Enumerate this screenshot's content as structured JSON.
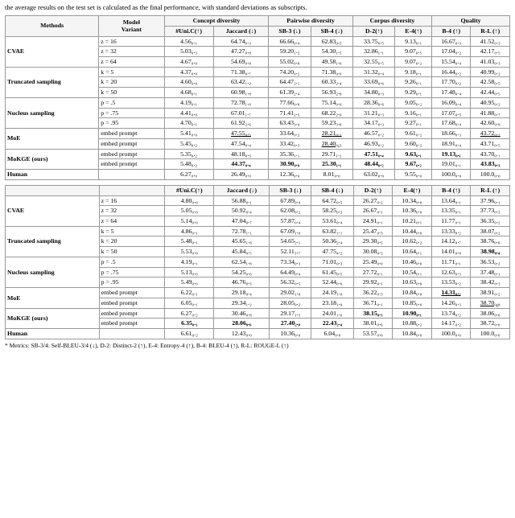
{
  "intro": "the average results on the test set is calculated as the final performance, with standard deviations as subscripts.",
  "table1": {
    "col_groups": [
      {
        "label": "Methods",
        "cols": [
          "Model Variant"
        ]
      },
      {
        "label": "Concept diversity",
        "cols": [
          "#Uni.C(↑)",
          "Jaccard (↓)"
        ]
      },
      {
        "label": "Pairwise diversity",
        "cols": [
          "SB-3 (↓)",
          "SB-4 (↓)"
        ]
      },
      {
        "label": "Corpus diversity",
        "cols": [
          "D-2(↑)",
          "E-4(↑)"
        ]
      },
      {
        "label": "Quality",
        "cols": [
          "B-4 (↑)",
          "R-L (↑)"
        ]
      }
    ],
    "rows": [
      {
        "method": "CVAE",
        "variants": [
          {
            "var": "z = 16",
            "vals": [
              "4.56₀.₁",
              "64.74₀.₃",
              "66.66₀.₄",
              "62.83₀.₅",
              "33.75₀.₅",
              "9.13₀.₁",
              "16.67₀.₃",
              "41.52₀.₃"
            ]
          },
          {
            "var": "z = 32",
            "vals": [
              "5.03₀.₃",
              "47.27₀.₈",
              "59.20₁.₃",
              "54.30₁.₅",
              "32.86₁.₁",
              "9.07₀.₅",
              "17.04₀.₂",
              "42.17₀.₅"
            ]
          },
          {
            "var": "z = 64",
            "vals": [
              "4.67₀.₀",
              "54.69₀.₈",
              "55.02₀.₈",
              "49.58₁.₀",
              "32.55₀.₅",
              "9.07₀.₂",
              "15.54₀.₄",
              "41.03₀.₃"
            ]
          }
        ]
      },
      {
        "method": "Truncated sampling",
        "variants": [
          {
            "var": "k = 5",
            "vals": [
              "4.37₀.₀",
              "71.38₀.₇",
              "74.20₀.₂",
              "71.38₀.₀",
              "31.32₀.₄",
              "9.18₀.₁",
              "16.44₀.₂",
              "40.99₀.₂"
            ]
          },
          {
            "var": "k = 20",
            "vals": [
              "4.60₀.₀",
              "63.42₁.₂",
              "64.47₂.₁",
              "60.33₂.₄",
              "33.69₀.₆",
              "9.26₀.₁",
              "17.70₀.₂",
              "42.58₀.₅"
            ]
          },
          {
            "var": "k = 50",
            "vals": [
              "4.68₀.₁",
              "60.98₁.₈",
              "61.39₂.₄",
              "56.93₂.₈",
              "34.80₀.₃",
              "9.29₀.₁",
              "17.48₀.₄",
              "42.44₀.₅"
            ]
          }
        ]
      },
      {
        "method": "Nucleus sampling",
        "variants": [
          {
            "var": "p = .5",
            "vals": [
              "4.19₀.₁",
              "72.78₁.₀",
              "77.66₀.₈",
              "75.14₀.₉",
              "28.36₀.₆",
              "9.05₀.₂",
              "16.09₀.₄",
              "40.95₀.₂"
            ]
          },
          {
            "var": "p = .75",
            "vals": [
              "4.41₀.₀",
              "67.01₁.₇",
              "71.41₂.₅",
              "68.22₂.₉",
              "31.21₀.₃",
              "9.16₀.₁",
              "17.07₀.₅",
              "41.88₀.₇"
            ]
          },
          {
            "var": "p = .95",
            "vals": [
              "4.70₀.₁",
              "61.92₂.₆",
              "63.43₃.₄",
              "59.23₃.₈",
              "34.17₀.₃",
              "9.27₀.₁",
              "17.68₀.₄",
              "42.60₀.₈"
            ]
          }
        ]
      },
      {
        "method": "MoE",
        "variants": [
          {
            "var": "embed prompt",
            "vals": [
              "5.41₀.₀",
              "47.55₀.₅",
              "33.64₀.₂",
              "28.21₀.₁",
              "46.57₀.₂",
              "9.61₀.₂",
              "18.66₀.₃",
              "43.72₀.₂"
            ],
            "special": [
              false,
              true,
              false,
              true,
              false,
              false,
              false,
              true
            ]
          },
          {
            "var": "embed prompt",
            "vals": [
              "5.45₀.₂",
              "47.54₀.₄",
              "33.42₀.₃",
              "28.40₀.₃",
              "46.93₀.₂",
              "9.60₀.₂",
              "18.91₀.₄",
              "43.71₀.₅"
            ],
            "special": [
              false,
              false,
              false,
              true,
              false,
              false,
              false,
              false
            ]
          }
        ]
      },
      {
        "method": "MoKGE (ours)",
        "variants": [
          {
            "var": "embed prompt",
            "vals": [
              "5.35₀.₂",
              "48.18₀.₅",
              "35.36₁.₁",
              "29.71₁.₂",
              "47.51₀.₄",
              "9.63₀.₁",
              "19.13₀.₁",
              "43.70₀.₁"
            ],
            "special": [
              false,
              false,
              false,
              false,
              true,
              true,
              true,
              false
            ],
            "bold": [
              false,
              false,
              false,
              false,
              true,
              true,
              true,
              false
            ]
          },
          {
            "var": "embed prompt",
            "vals": [
              "5.48₀.₂",
              "44.37₀.₄",
              "30.90₀.₉",
              "25.30₁.₁",
              "48.44₀.₂",
              "9.67₀.₂",
              "19.01₀.₁",
              "43.83₀.₃"
            ],
            "bold": [
              false,
              true,
              true,
              true,
              true,
              true,
              false,
              true
            ]
          }
        ]
      },
      {
        "method": "Human",
        "variants": [
          {
            "var": "",
            "vals": [
              "6.27₀.₀",
              "26.49₀.₀",
              "12.36₀.₀",
              "8.01₀.₀",
              "63.02₀.₀",
              "9.55₀.₀",
              "100.0₀.₀",
              "100.0₀.₀"
            ]
          }
        ]
      }
    ]
  },
  "table2": {
    "rows": [
      {
        "method": "CVAE",
        "variants": [
          {
            "var": "z = 16",
            "vals": [
              "4.80₀.₀",
              "56.88₀.₁",
              "67.89₀.₄",
              "64.72₀.₅",
              "26.27₀.₂",
              "10.34₀.₀",
              "13.64₀.₁",
              "37.96₀.₁"
            ]
          },
          {
            "var": "z = 32",
            "vals": [
              "5.05₀.₀",
              "50.92₀.₄",
              "62.08₀.₂",
              "58.25₀.₃",
              "26.67₀.₁",
              "10.36₀.₀",
              "13.35₀.₁",
              "37.73₀.₃"
            ]
          },
          {
            "var": "z = 64",
            "vals": [
              "5.14₀.₀",
              "47.04₀.₇",
              "57.87₀.₄",
              "53.61₀.₄",
              "24.91₀.₁",
              "10.21₀.₁",
              "11.77₀.₁",
              "36.35₀.₂"
            ]
          }
        ]
      },
      {
        "method": "Truncated sampling",
        "variants": [
          {
            "var": "k = 5",
            "vals": [
              "4.86₀.₁",
              "72.78₁.₁",
              "67.09₁.₀",
              "63.82₁.₁",
              "25.47₀.₃",
              "10.44₀.₀",
              "13.33₀.₂",
              "38.07₀.₂"
            ]
          },
          {
            "var": "k = 20",
            "vals": [
              "5.48₀.₁",
              "45.65₁.₈",
              "54.65₂.₁",
              "50.36₂.₄",
              "29.30₀.₅",
              "10.62₀.₂",
              "14.12₀.₇",
              "38.76₀.₆"
            ]
          },
          {
            "var": "k = 50",
            "vals": [
              "5.53₀.₀",
              "45.84₀.₅",
              "52.11₃.₇",
              "47.75₄.₂",
              "30.08₀.₃",
              "10.64₀.₁",
              "14.01₀.₈",
              "38.98₀.₄"
            ],
            "bold": [
              false,
              false,
              false,
              false,
              false,
              false,
              false,
              true
            ]
          }
        ]
      },
      {
        "method": "Nucleus sampling",
        "variants": [
          {
            "var": "p = .5",
            "vals": [
              "4.19₀.₁",
              "62.54₁.₈",
              "73.34₀.₃",
              "71.01₀.₃",
              "25.49₀.₀",
              "10.46₀.₀",
              "11.71₀.₁",
              "36.53₀.₂"
            ]
          },
          {
            "var": "p = .75",
            "vals": [
              "5.13₀.₀",
              "54.25₀.₆",
              "64.49₀.₄",
              "61.45₀.₅",
              "27.72₀.₁",
              "10.54₀.₁",
              "12.63₀.₃",
              "37.48₀.₁"
            ]
          },
          {
            "var": "p = .95",
            "vals": [
              "5.49₀.₀",
              "46.76₀.₅",
              "56.32₀.₅",
              "52.44₀.₆",
              "29.92₀.₁",
              "10.63₀.₀",
              "13.53₀.₂",
              "38.42₀.₃"
            ]
          }
        ]
      },
      {
        "method": "MoE",
        "variants": [
          {
            "var": "embed prompt",
            "vals": [
              "6.22₀.₁",
              "29.18₀.₄",
              "29.02₁.₀",
              "24.19₁.₀",
              "36.22₀.₃",
              "10.84₀.₀",
              "14.31₀.₂",
              "38.91₀.₂"
            ],
            "bold": [
              false,
              false,
              false,
              false,
              false,
              false,
              true,
              false
            ],
            "underline": [
              false,
              false,
              false,
              false,
              false,
              false,
              true,
              false
            ]
          },
          {
            "var": "embed prompt",
            "vals": [
              "6.05₀.₁",
              "29.34₁.₂",
              "28.05₀.₂",
              "23.18₁.₉",
              "36.71₀.₁",
              "10.85₀.₀",
              "14.26₀.₃",
              "38.70₀.₈"
            ],
            "underline": [
              false,
              false,
              false,
              false,
              false,
              false,
              false,
              true
            ]
          }
        ]
      },
      {
        "method": "MoKGE (ours)",
        "variants": [
          {
            "var": "embed prompt",
            "vals": [
              "6.27₀.₂",
              "30.46₀.₈",
              "29.17₁.₅",
              "24.01₁.₆",
              "38.15₀.₃",
              "10.90₀.₁",
              "13.74₀.₂",
              "38.06₀.₆"
            ],
            "bold": [
              false,
              false,
              false,
              false,
              true,
              true,
              false,
              false
            ]
          },
          {
            "var": "embed prompt",
            "vals": [
              "6.35₀.₁",
              "28.06₀.₆",
              "27.40₂.₀",
              "22.43₂.₄",
              "38.01₀.₆",
              "10.88₀.₂",
              "14.17₀.₂",
              "38.72₀.₀"
            ],
            "bold": [
              true,
              true,
              true,
              true,
              false,
              false,
              false,
              false
            ]
          }
        ]
      },
      {
        "method": "Human",
        "variants": [
          {
            "var": "",
            "vals": [
              "6.61₀.₂",
              "12.43₀.₀",
              "10.36₀.₀",
              "6.04₀.₀",
              "53.57₀.₀",
              "10.84₀.₀",
              "100.0₀.₀",
              "100.0₀.₀"
            ]
          }
        ]
      }
    ]
  },
  "footnote": "* Metrics: SB-3/4: Self-BLEU-3/4 (↓), D-2: Distinct-2 (↑), E-4: Entropy-4 (↑), B-4: BLEU-4 (↑), R-L: ROUGE-L (↑)"
}
